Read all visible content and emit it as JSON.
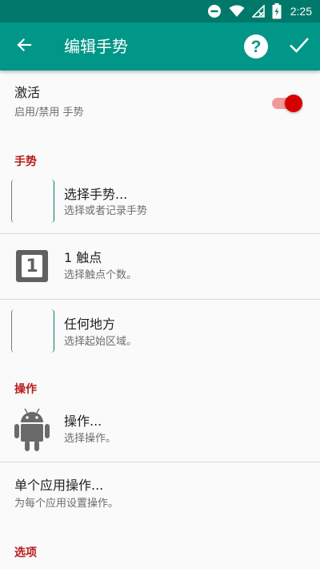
{
  "status_bar": {
    "time": "2:25",
    "icons": [
      "do-not-disturb-icon",
      "wifi-icon",
      "no-signal-icon",
      "battery-charging-icon"
    ]
  },
  "app_bar": {
    "title": "编辑手势",
    "back_icon": "arrow-back-icon",
    "help_icon": "help-circle-icon",
    "done_icon": "checkmark-icon",
    "background": "#009688",
    "status_background": "#00796b"
  },
  "activate": {
    "title": "激活",
    "subtitle": "启用/禁用 手势",
    "enabled": true,
    "accent": "#d50000"
  },
  "sections": {
    "gesture": "手势",
    "action": "操作",
    "options": "选项"
  },
  "gesture_items": [
    {
      "title": "选择手势...",
      "subtitle": "选择或者记录手势",
      "icon": "gesture-box-icon"
    },
    {
      "title": "1 触点",
      "subtitle": "选择触点个数。",
      "icon": "touch-count-icon",
      "icon_digit": "1"
    },
    {
      "title": "任何地方",
      "subtitle": "选择起始区域。",
      "icon": "area-box-icon"
    }
  ],
  "action_items": [
    {
      "title": "操作...",
      "subtitle": "选择操作。",
      "icon": "android-icon"
    },
    {
      "title": "单个应用操作...",
      "subtitle": "为每个应用设置操作。"
    }
  ]
}
